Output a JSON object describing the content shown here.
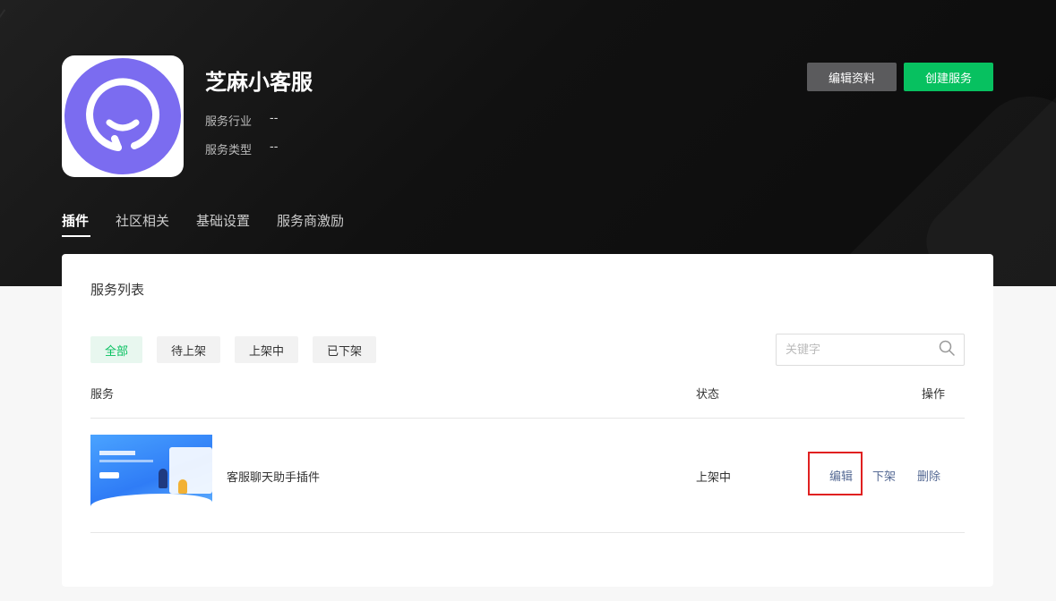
{
  "header": {
    "app_name": "芝麻小客服",
    "meta": [
      {
        "label": "服务行业",
        "value": "--"
      },
      {
        "label": "服务类型",
        "value": "--"
      }
    ],
    "buttons": {
      "edit_profile": "编辑资料",
      "create_service": "创建服务"
    },
    "logo": {
      "icon": "smile-chat-icon",
      "color": "#7b6cf0"
    }
  },
  "tabs": [
    "插件",
    "社区相关",
    "基础设置",
    "服务商激励"
  ],
  "card": {
    "title": "服务列表",
    "filters": [
      "全部",
      "待上架",
      "上架中",
      "已下架"
    ],
    "search": {
      "placeholder": "关键字",
      "icon": "search-icon"
    },
    "columns": {
      "service": "服务",
      "status": "状态",
      "actions": "操作"
    },
    "rows": [
      {
        "name": "客服聊天助手插件",
        "status": "上架中",
        "actions": {
          "edit": "编辑",
          "unlist": "下架",
          "delete": "删除"
        }
      }
    ]
  },
  "colors": {
    "accent": "#07c160",
    "link": "#576b95",
    "highlight": "#e02020"
  }
}
